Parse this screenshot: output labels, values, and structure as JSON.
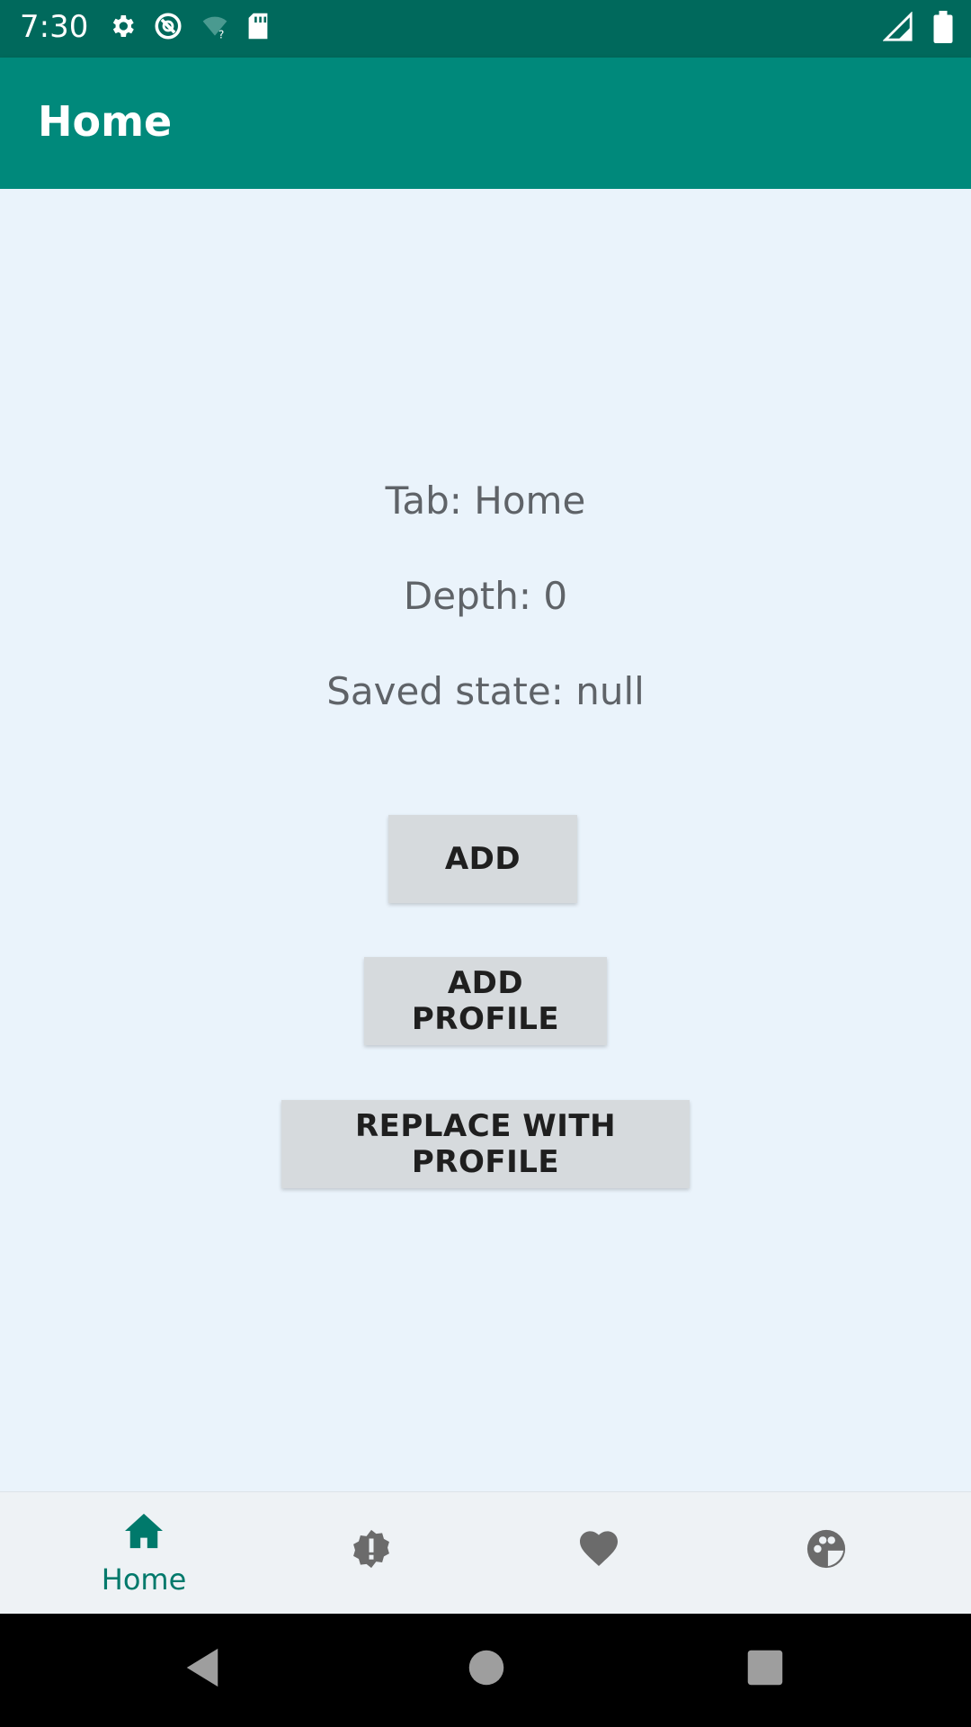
{
  "status_bar": {
    "time": "7:30",
    "icons": [
      "settings-icon",
      "sync-icon",
      "wifi-unknown-icon",
      "sd-card-icon",
      "signal-icon",
      "battery-icon"
    ]
  },
  "app_bar": {
    "title": "Home",
    "color": "#00897b"
  },
  "content": {
    "tab_text": "Tab: Home",
    "depth_text": "Depth: 0",
    "saved_state_text": "Saved state: null",
    "buttons": {
      "add": "ADD",
      "add_profile": "ADD PROFILE",
      "replace_with_profile": "REPLACE WITH PROFILE"
    }
  },
  "bottom_nav": {
    "items": [
      {
        "icon": "home-icon",
        "label": "Home",
        "selected": true
      },
      {
        "icon": "alert-badge-icon",
        "label": "",
        "selected": false
      },
      {
        "icon": "heart-icon",
        "label": "",
        "selected": false
      },
      {
        "icon": "palette-icon",
        "label": "",
        "selected": false
      }
    ],
    "active_color": "#00796b"
  },
  "system_nav": {
    "icons": [
      "back-icon",
      "home-circle-icon",
      "recents-icon"
    ]
  }
}
